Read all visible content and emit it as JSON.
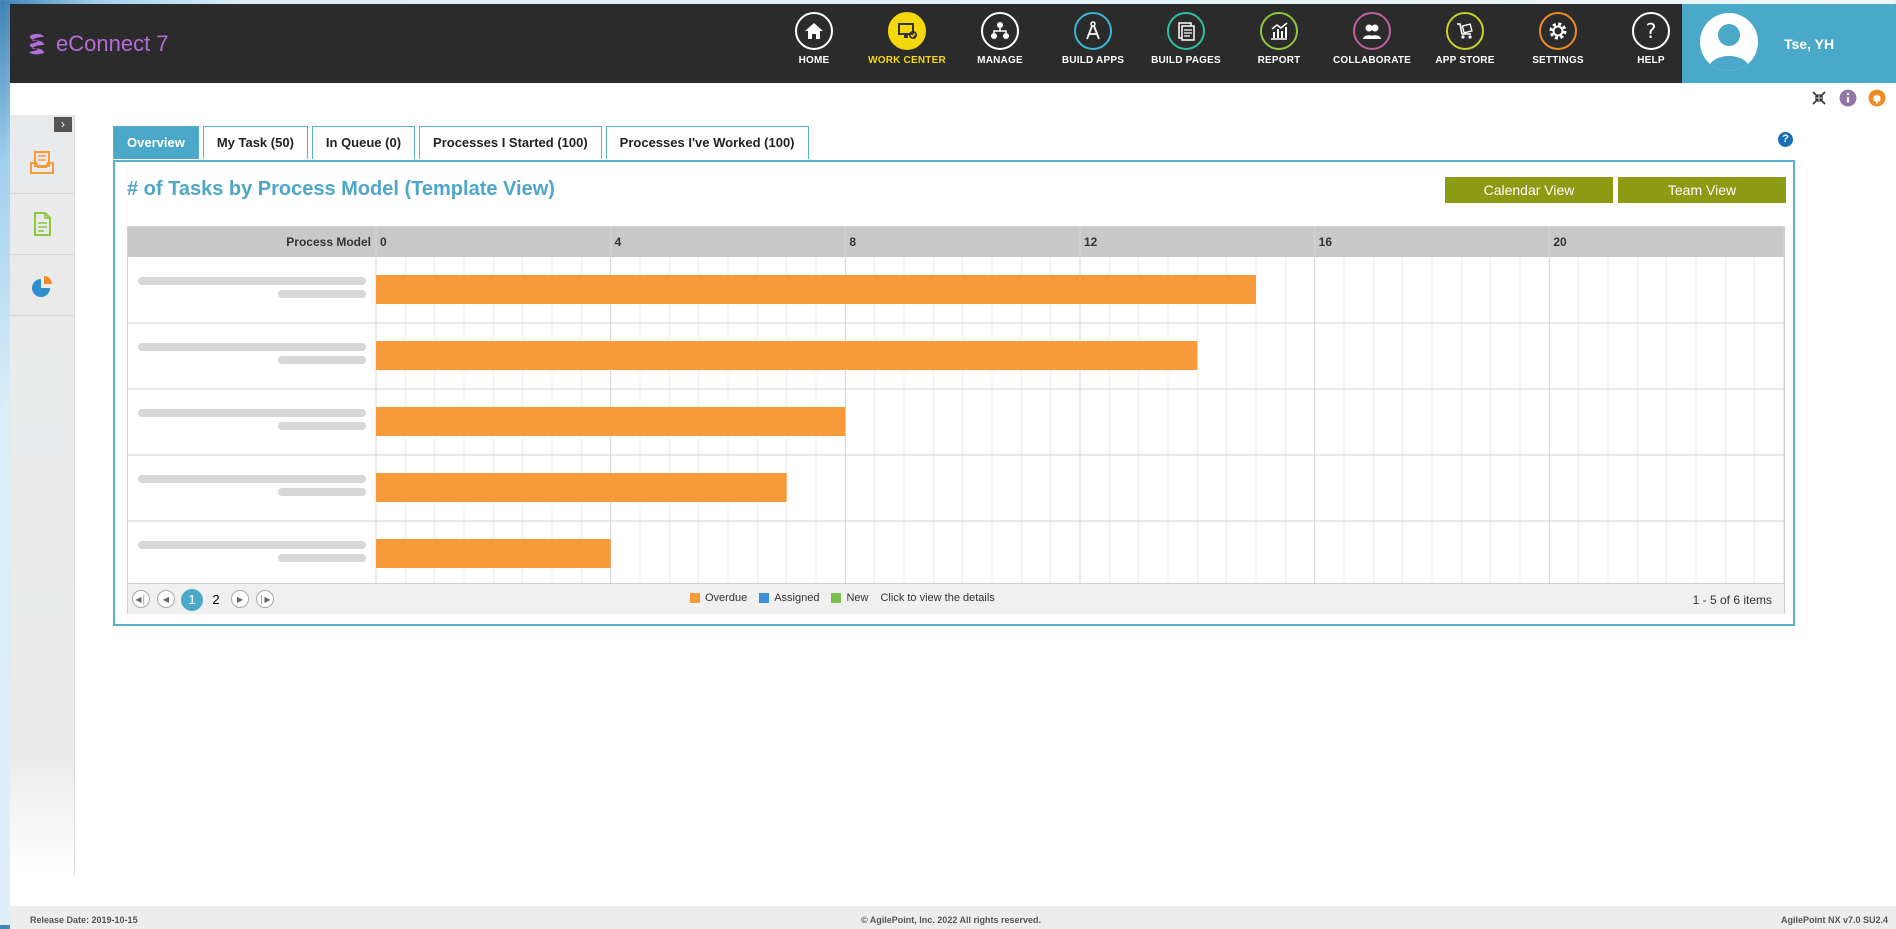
{
  "app": {
    "title": "eConnect 7"
  },
  "nav": [
    {
      "label": "HOME",
      "icon": "home-icon",
      "color": "#ffffff",
      "active": false
    },
    {
      "label": "WORK CENTER",
      "icon": "work-center-icon",
      "color": "#f4d80c",
      "active": true
    },
    {
      "label": "MANAGE",
      "icon": "manage-icon",
      "color": "#ffffff",
      "active": false
    },
    {
      "label": "BUILD APPS",
      "icon": "build-apps-icon",
      "color": "#3cb6d6",
      "active": false
    },
    {
      "label": "BUILD PAGES",
      "icon": "build-pages-icon",
      "color": "#2fbfa0",
      "active": false
    },
    {
      "label": "REPORT",
      "icon": "report-icon",
      "color": "#8cc63f",
      "active": false
    },
    {
      "label": "COLLABORATE",
      "icon": "collaborate-icon",
      "color": "#c060a0",
      "active": false
    },
    {
      "label": "APP STORE",
      "icon": "app-store-icon",
      "color": "#c7d12a",
      "active": false
    },
    {
      "label": "SETTINGS",
      "icon": "settings-icon",
      "color": "#f08a24",
      "active": false
    },
    {
      "label": "HELP",
      "icon": "help-icon",
      "color": "#ffffff",
      "active": false
    }
  ],
  "user": {
    "name": "Tse, YH"
  },
  "tabs": [
    {
      "label": "Overview",
      "active": true
    },
    {
      "label": "My Task (50)",
      "active": false
    },
    {
      "label": "In Queue (0)",
      "active": false
    },
    {
      "label": "Processes I Started (100)",
      "active": false
    },
    {
      "label": "Processes I've Worked (100)",
      "active": false
    }
  ],
  "panel": {
    "title": "# of Tasks by Process Model (Template View)",
    "calendar_view_label": "Calendar View",
    "team_view_label": "Team View"
  },
  "chart_data": {
    "type": "bar",
    "orientation": "horizontal",
    "category_header": "Process Model",
    "categories": [
      "",
      "",
      "",
      "",
      ""
    ],
    "series": [
      {
        "name": "Overdue",
        "color": "#f79a3a",
        "values": [
          15,
          14,
          8,
          7,
          4
        ]
      },
      {
        "name": "Assigned",
        "color": "#3b8fd8",
        "values": [
          0,
          0,
          0,
          0,
          0
        ]
      },
      {
        "name": "New",
        "color": "#7cbf4e",
        "values": [
          0,
          0,
          0,
          0,
          0
        ]
      }
    ],
    "xticks": [
      "0",
      "4",
      "8",
      "12",
      "16",
      "20"
    ],
    "xlim": [
      0,
      24
    ],
    "grid": true
  },
  "legend_hint": "Click to view the details",
  "pager": {
    "pages": [
      "1",
      "2"
    ],
    "current": "1",
    "items_text": "1 - 5 of 6 items"
  },
  "footer": {
    "release": "Release Date: 2019-10-15",
    "copyright": "© AgilePoint, Inc. 2022 All rights reserved.",
    "version": "AgilePoint NX v7.0 SU2.4"
  }
}
